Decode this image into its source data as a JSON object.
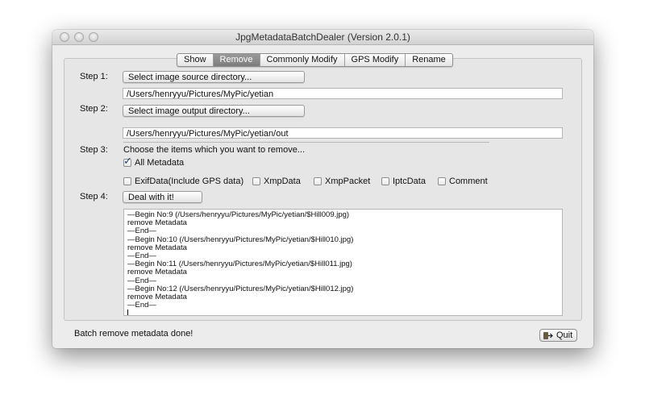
{
  "window": {
    "title": "JpgMetadataBatchDealer (Version 2.0.1)"
  },
  "tabs": [
    {
      "label": "Show",
      "active": false
    },
    {
      "label": "Remove",
      "active": true
    },
    {
      "label": "Commonly Modify",
      "active": false
    },
    {
      "label": "GPS Modify",
      "active": false
    },
    {
      "label": "Rename",
      "active": false
    }
  ],
  "step1": {
    "label": "Step 1:",
    "button": "Select image source directory...",
    "path": "/Users/henryyu/Pictures/MyPic/yetian"
  },
  "step2": {
    "label": "Step 2:",
    "button": "Select image output directory...",
    "path": "/Users/henryyu/Pictures/MyPic/yetian/out"
  },
  "step3": {
    "label": "Step 3:",
    "instruction": "Choose the items which you want to remove...",
    "all_metadata": {
      "label": "All Metadata",
      "checked": true
    },
    "options": [
      {
        "label": "ExifData(Include GPS data)",
        "checked": false
      },
      {
        "label": "XmpData",
        "checked": false
      },
      {
        "label": "XmpPacket",
        "checked": false
      },
      {
        "label": "IptcData",
        "checked": false
      },
      {
        "label": "Comment",
        "checked": false
      }
    ]
  },
  "step4": {
    "label": "Step 4:",
    "button": "Deal with it!"
  },
  "log": [
    "—Begin No:9 (/Users/henryyu/Pictures/MyPic/yetian/$Hill009.jpg)",
    "remove Metadata",
    "—End—",
    "—Begin No:10 (/Users/henryyu/Pictures/MyPic/yetian/$Hill010.jpg)",
    "remove Metadata",
    "—End—",
    "—Begin No:11 (/Users/henryyu/Pictures/MyPic/yetian/$Hill011.jpg)",
    "remove Metadata",
    "—End—",
    "—Begin No:12 (/Users/henryyu/Pictures/MyPic/yetian/$Hill012.jpg)",
    "remove Metadata",
    "—End—"
  ],
  "status": "Batch remove metadata done!",
  "quit_button": {
    "label": "Quit",
    "icon": "quit-icon"
  },
  "colors": {
    "active_tab": "#8a8a8a",
    "check": "#1f3d7a"
  }
}
